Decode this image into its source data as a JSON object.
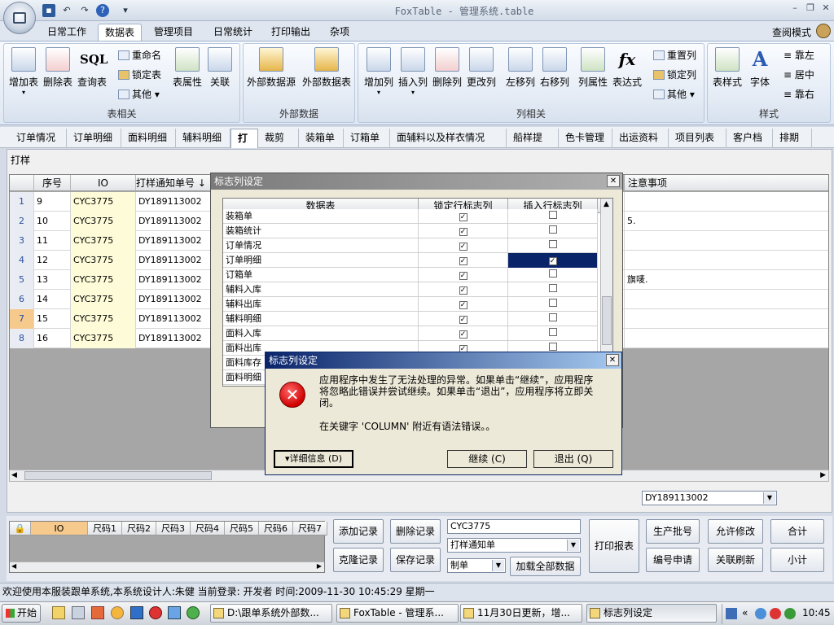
{
  "window": {
    "title": "FoxTable - 管理系统.table"
  },
  "ribbon_tabs": [
    {
      "label": "日常工作"
    },
    {
      "label": "数据表"
    },
    {
      "label": "管理项目"
    },
    {
      "label": "日常统计"
    },
    {
      "label": "打印输出"
    },
    {
      "label": "杂项"
    }
  ],
  "view_mode": "查阅模式",
  "ribbon": {
    "table_group": {
      "label": "表相关",
      "add_table": "增加表",
      "delete_table": "删除表",
      "sql_icon_text": "SQL",
      "query_table": "查询表",
      "rename": "重命名",
      "lock_table": "锁定表",
      "other": "其他",
      "table_props": "表属性",
      "relation": "关联"
    },
    "external_group": {
      "label": "外部数据",
      "source": "外部数据源",
      "table": "外部数据表"
    },
    "column_group": {
      "label": "列相关",
      "add_col": "增加列",
      "insert_col": "插入列",
      "delete_col": "删除列",
      "change_col": "更改列",
      "move_left": "左移列",
      "move_right": "右移列",
      "col_props": "列属性",
      "expression": "表达式",
      "reset_cols": "重置列",
      "lock_cols": "锁定列",
      "other": "其他"
    },
    "style_group": {
      "label": "样式",
      "table_style": "表样式",
      "font": "字体",
      "align_left": "靠左",
      "align_center": "居中",
      "align_right": "靠右"
    }
  },
  "doc_tabs": [
    "订单情况",
    "订单明细",
    "面料明细",
    "辅料明细",
    "打样",
    "裁剪数",
    "装箱单",
    "订箱单",
    "面辅料以及样衣情况",
    "船样提取",
    "色卡管理",
    "出运资料",
    "项目列表",
    "客户档案",
    "排期表"
  ],
  "panel_title": "打样",
  "grid": {
    "headers": {
      "seq": "序号",
      "io": "IO",
      "notice": "打样通知单号 ↓",
      "notes": "注意事项"
    },
    "rows": [
      {
        "n": "1",
        "seq": "9",
        "io": "CYC3775",
        "notice": "DY189113002",
        "extra": "90",
        "notes": ""
      },
      {
        "n": "2",
        "seq": "10",
        "io": "CYC3775",
        "notice": "DY189113002",
        "extra": "90",
        "notes": "5."
      },
      {
        "n": "3",
        "seq": "11",
        "io": "CYC3775",
        "notice": "DY189113002",
        "extra": "",
        "notes": ""
      },
      {
        "n": "4",
        "seq": "12",
        "io": "CYC3775",
        "notice": "DY189113002",
        "extra": "",
        "notes": ""
      },
      {
        "n": "5",
        "seq": "13",
        "io": "CYC3775",
        "notice": "DY189113002",
        "extra": "",
        "notes": "旗唛."
      },
      {
        "n": "6",
        "seq": "14",
        "io": "CYC3775",
        "notice": "DY189113002",
        "extra": "",
        "notes": ""
      },
      {
        "n": "7",
        "seq": "15",
        "io": "CYC3775",
        "notice": "DY189113002",
        "extra": "",
        "notes": ""
      },
      {
        "n": "8",
        "seq": "16",
        "io": "CYC3775",
        "notice": "DY189113002",
        "extra": "",
        "notes": ""
      }
    ]
  },
  "filter_combo": "DY189113002",
  "mini_grid": {
    "headers": [
      "IO",
      "尺码1",
      "尺码2",
      "尺码3",
      "尺码4",
      "尺码5",
      "尺码6",
      "尺码7"
    ]
  },
  "buttons": {
    "add_record": "添加记录",
    "delete_record": "删除记录",
    "clone_record": "克隆记录",
    "save_record": "保存记录",
    "load_all": "加载全部数据",
    "print_report": "打印报表",
    "batch_no": "生产批号",
    "allow_edit": "允许修改",
    "total": "合计",
    "number_apply": "编号申请",
    "refresh_relation": "关联刷新",
    "subtotal": "小计"
  },
  "fields": {
    "io_value": "CYC3775",
    "notice_select": "打样通知单",
    "make_select": "制单"
  },
  "status": "欢迎使用本服装跟单系统,本系统设计人:朱健    当前登录: 开发者  时间:2009-11-30 10:45:29  星期一",
  "taskbar": {
    "start": "开始",
    "items": [
      "D:\\跟单系统外部数...",
      "FoxTable - 管理系...",
      "11月30日更新，增...",
      "标志列设定"
    ],
    "clock": "10:45"
  },
  "dialog_back": {
    "title": "标志列设定",
    "headers": {
      "table": "数据表",
      "lock": "锁定行标志列",
      "insert": "插入行标志列"
    },
    "rows": [
      {
        "name": "装箱单",
        "lock": true,
        "insert": false
      },
      {
        "name": "装箱统计",
        "lock": true,
        "insert": false
      },
      {
        "name": "订单情况",
        "lock": true,
        "insert": false
      },
      {
        "name": "订单明细",
        "lock": true,
        "insert": true
      },
      {
        "name": "订箱单",
        "lock": true,
        "insert": false
      },
      {
        "name": "辅料入库",
        "lock": true,
        "insert": false
      },
      {
        "name": "辅料出库",
        "lock": true,
        "insert": false
      },
      {
        "name": "辅料明细",
        "lock": true,
        "insert": false
      },
      {
        "name": "面料入库",
        "lock": true,
        "insert": false
      },
      {
        "name": "面料出库",
        "lock": true,
        "insert": false
      },
      {
        "name": "面料库存",
        "lock": false,
        "insert": false
      },
      {
        "name": "面料明细",
        "lock": false,
        "insert": false
      }
    ]
  },
  "dialog_error": {
    "title": "标志列设定",
    "message": "应用程序中发生了无法处理的异常。如果单击“继续”，应用程序将忽略此错误并尝试继续。如果单击“退出”，应用程序将立即关闭。",
    "detail": "在关键字 'COLUMN' 附近有语法错误。。",
    "details_btn": "详细信息 (D)",
    "continue_btn": "继续 (C)",
    "exit_btn": "退出 (Q)"
  },
  "colors": {
    "ribbon_accent": "#9fb1ca",
    "dialog_title": "#0a246a",
    "row_highlight": "#f6c98d",
    "io_column": "#fefcd8",
    "error_red": "#e00000",
    "selected_cell": "#0a246a"
  }
}
